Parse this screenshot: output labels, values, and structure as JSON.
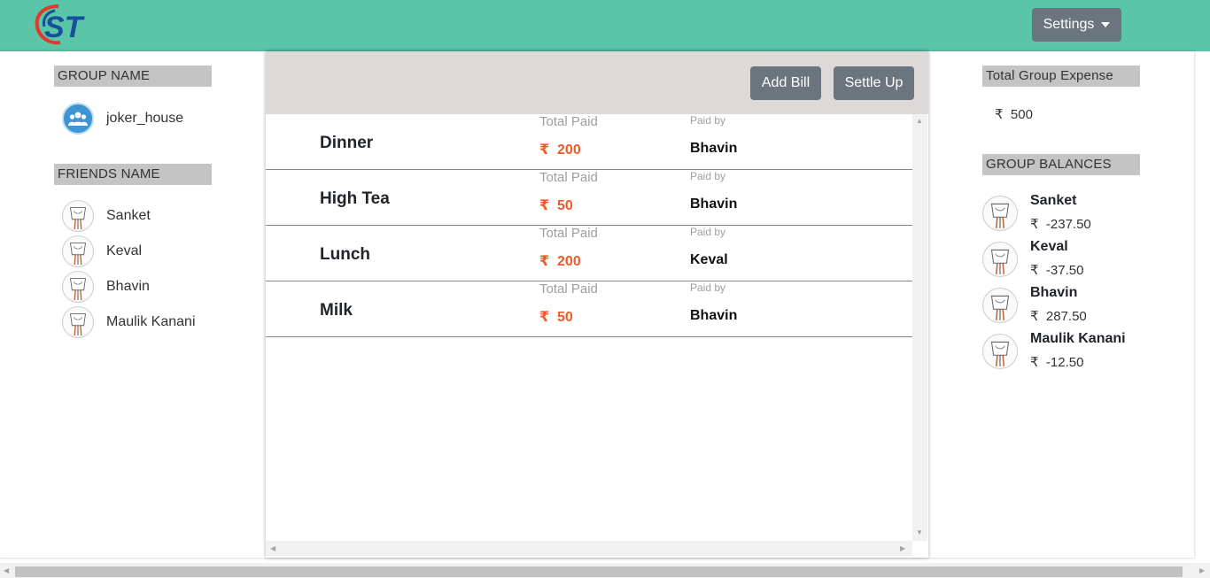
{
  "app": {
    "logo_text": "ST",
    "settings_label": "Settings"
  },
  "left": {
    "group_header": "GROUP NAME",
    "group_name": "joker_house",
    "friends_header": "FRIENDS NAME",
    "friends": [
      "Sanket",
      "Keval",
      "Bhavin",
      "Maulik Kanani"
    ]
  },
  "center": {
    "add_bill_label": "Add Bill",
    "settle_up_label": "Settle Up",
    "total_paid_label": "Total Paid",
    "paid_by_label": "Paid by",
    "currency": "₹",
    "bills": [
      {
        "name": "Dinner",
        "amount": "200",
        "paid_by": "Bhavin"
      },
      {
        "name": "High Tea",
        "amount": "50",
        "paid_by": "Bhavin"
      },
      {
        "name": "Lunch",
        "amount": "200",
        "paid_by": "Keval"
      },
      {
        "name": "Milk",
        "amount": "50",
        "paid_by": "Bhavin"
      }
    ]
  },
  "right": {
    "total_header": "Total Group Expense",
    "total_value": "500",
    "balances_header": "GROUP BALANCES",
    "balances": [
      {
        "name": "Sanket",
        "amount": "-237.50"
      },
      {
        "name": "Keval",
        "amount": "-37.50"
      },
      {
        "name": "Bhavin",
        "amount": "287.50"
      },
      {
        "name": "Maulik Kanani",
        "amount": "-12.50"
      }
    ]
  },
  "colors": {
    "navbar": "#5ac5a7",
    "button": "#6c757d",
    "amount": "#f05a28",
    "section_header": "#c4c4c4"
  }
}
